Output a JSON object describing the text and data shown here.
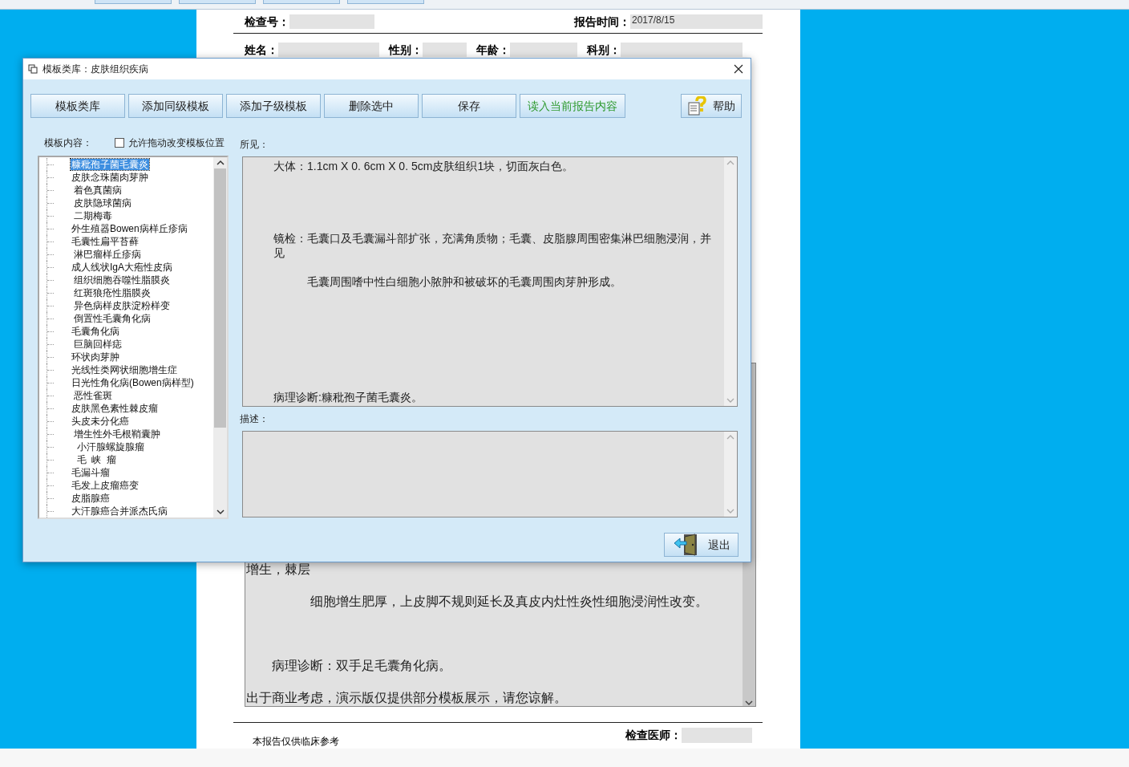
{
  "report": {
    "row_1": [
      {
        "label": "检查号："
      },
      {
        "label": "报告时间：",
        "value": "2017/8/15"
      }
    ],
    "row_2": [
      {
        "label": "姓名："
      },
      {
        "label": "性别："
      },
      {
        "label": "年龄："
      },
      {
        "label": "科别："
      }
    ],
    "body_lines": [
      "增生，棘层",
      "　　　　　细胞增生肥厚，上皮脚不规则延长及真皮内灶性炎性细胞浸润性改变。",
      "　　病理诊断：双手足毛囊角化病。",
      "出于商业考虑，演示版仅提供部分模板展示，请您谅解。"
    ],
    "footer_note": "本报告仅供临床参考",
    "doctor_label": "检查医师："
  },
  "dialog": {
    "title": "模板类库：皮肤组织疾病",
    "buttons": [
      {
        "label": "模板类库",
        "kind": "plain"
      },
      {
        "label": "添加同级模板",
        "kind": "plain"
      },
      {
        "label": "添加子级模板",
        "kind": "plain"
      },
      {
        "label": "删除选中",
        "kind": "plain"
      },
      {
        "label": "保存",
        "kind": "plain"
      },
      {
        "label": "读入当前报告内容",
        "kind": "load"
      },
      {
        "label": "帮助",
        "kind": "help"
      }
    ],
    "template_label": "模板内容：",
    "allow_drag": {
      "label": "允许拖动改变模板位置",
      "checked": false
    },
    "tree": [
      {
        "label": "糠秕孢子菌毛囊炎",
        "selected": true
      },
      {
        "label": "皮肤念珠菌肉芽肿",
        "selected": false
      },
      {
        "label": " 着色真菌病",
        "selected": false
      },
      {
        "label": " 皮肤隐球菌病",
        "selected": false
      },
      {
        "label": " 二期梅毒",
        "selected": false
      },
      {
        "label": "外生殖器Bowen病样丘疹病",
        "selected": false
      },
      {
        "label": "毛囊性扁平苔藓",
        "selected": false
      },
      {
        "label": " 淋巴瘤样丘疹病",
        "selected": false
      },
      {
        "label": "成人线状IgA大疱性皮病",
        "selected": false
      },
      {
        "label": " 组织细胞吞噬性脂膜炎",
        "selected": false
      },
      {
        "label": " 红斑狼疮性脂膜炎",
        "selected": false
      },
      {
        "label": " 异色病样皮肤淀粉样变",
        "selected": false
      },
      {
        "label": " 倒置性毛囊角化病",
        "selected": false
      },
      {
        "label": "毛囊角化病",
        "selected": false
      },
      {
        "label": " 巨脑回样痣",
        "selected": false
      },
      {
        "label": "环状肉芽肿",
        "selected": false
      },
      {
        "label": "光线性类网状细胞增生症",
        "selected": false
      },
      {
        "label": "日光性角化病(Bowen病样型)",
        "selected": false
      },
      {
        "label": " 恶性雀斑",
        "selected": false
      },
      {
        "label": "皮肤黑色素性棘皮瘤",
        "selected": false
      },
      {
        "label": "头皮未分化癌",
        "selected": false
      },
      {
        "label": " 增生性外毛根鞘囊肿",
        "selected": false
      },
      {
        "label": "  小汗腺螺旋腺瘤",
        "selected": false
      },
      {
        "label": "  毛  峡  瘤",
        "selected": false
      },
      {
        "label": "毛漏斗瘤",
        "selected": false
      },
      {
        "label": "毛发上皮瘤癌变",
        "selected": false
      },
      {
        "label": "皮脂腺癌",
        "selected": false
      },
      {
        "label": "大汗腺癌合并派杰氏病",
        "selected": false
      }
    ],
    "findings_label": "所见：",
    "findings": [
      "大体：1.1cm X 0. 6cm X 0. 5cm皮肤组织1块，切面灰白色。",
      "镜检：毛囊口及毛囊漏斗部扩张，充满角质物；毛囊、皮脂腺周围密集淋巴细胞浸润，并见",
      "　　　毛囊周围嗜中性白细胞小脓肿和被破坏的毛囊周围肉芽肿形成。",
      "病理诊断:糠秕孢子菌毛囊炎。"
    ],
    "description_label": "描述：",
    "exit_button": "退出"
  }
}
